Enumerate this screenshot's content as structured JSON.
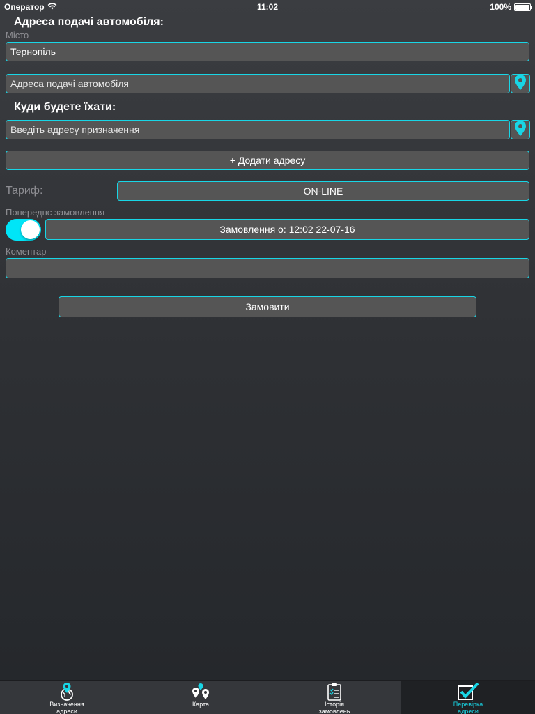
{
  "status_bar": {
    "carrier": "Оператор",
    "time": "11:02",
    "battery": "100%"
  },
  "pickup": {
    "heading": "Адреса подачі автомобіля:",
    "city_label": "Місто",
    "city_value": "Тернопіль",
    "address_placeholder": "Адреса подачі автомобіля"
  },
  "destination": {
    "heading": "Куди будете їхати:",
    "address_placeholder": "Введіть адресу призначення",
    "add_address_label": "+ Додати адресу"
  },
  "tariff": {
    "label": "Тариф:",
    "value": "ON-LINE"
  },
  "preorder": {
    "label": "Попереднє замовлення",
    "toggle_on": true,
    "order_time_label": "Замовлення о: 12:02 22-07-16"
  },
  "comment": {
    "label": "Коментар",
    "value": ""
  },
  "submit_label": "Замовити",
  "tabs": [
    {
      "icon": "globe-pin-icon",
      "label_line1": "Визначення",
      "label_line2": "адреси",
      "active": false
    },
    {
      "icon": "map-pins-icon",
      "label_line1": "Карта",
      "label_line2": "",
      "active": false
    },
    {
      "icon": "clipboard-icon",
      "label_line1": "Історія",
      "label_line2": "замовлень",
      "active": false
    },
    {
      "icon": "checkbox-icon",
      "label_line1": "Перевірка",
      "label_line2": "адреси",
      "active": true
    }
  ],
  "colors": {
    "accent": "#18d6e6",
    "field_bg": "#555555",
    "toggle_on": "#00e5f7"
  }
}
